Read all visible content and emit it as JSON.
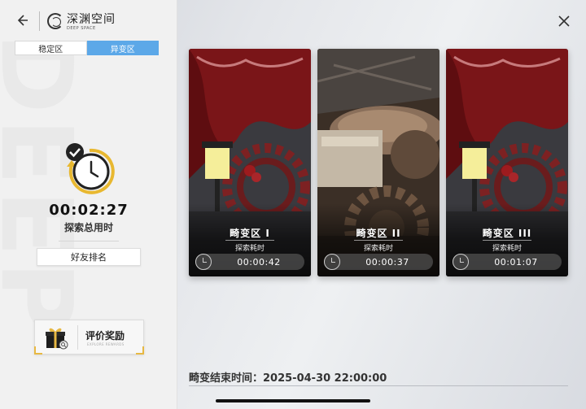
{
  "header": {
    "title": "深渊空间",
    "subtitle": "DEEP SPACE"
  },
  "tabs": [
    {
      "label": "稳定区",
      "active": false
    },
    {
      "label": "异变区",
      "active": true
    }
  ],
  "summary": {
    "total_time": "00:02:27",
    "total_label": "探索总用时",
    "friend_rank_label": "好友排名"
  },
  "reward": {
    "label": "评价奖励",
    "sublabel": "EXPLORE REWARDS"
  },
  "zones": [
    {
      "name": "畸变区 I",
      "label": "探索耗时",
      "time": "00:00:42"
    },
    {
      "name": "畸变区 II",
      "label": "探索耗时",
      "time": "00:00:37"
    },
    {
      "name": "畸变区 III",
      "label": "探索耗时",
      "time": "00:01:07"
    }
  ],
  "footer": {
    "end_time": "畸变结束时间：2025-04-30 22:00:00"
  },
  "colors": {
    "accent_blue": "#5ca8e8",
    "accent_gold": "#e7b843"
  },
  "icons": {
    "back": "arrow-left-icon",
    "close": "close-icon",
    "timer": "clock-check-icon",
    "gift": "gift-box-icon"
  }
}
